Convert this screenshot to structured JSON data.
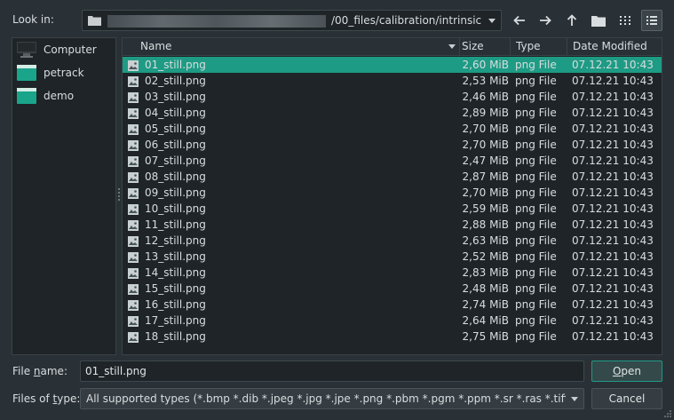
{
  "lookin": {
    "label": "Look in:",
    "path_suffix": "/00_files/calibration/intrinsic"
  },
  "sidebar": {
    "items": [
      {
        "label": "Computer",
        "icon": "computer-icon"
      },
      {
        "label": "petrack",
        "icon": "folder-icon"
      },
      {
        "label": "demo",
        "icon": "folder-icon"
      }
    ]
  },
  "list": {
    "headers": {
      "name": "Name",
      "size": "Size",
      "type": "Type",
      "date": "Date Modified"
    },
    "rows": [
      {
        "name": "01_still.png",
        "size": "2,60 MiB",
        "type": "png File",
        "date": "07.12.21 10:43",
        "selected": true
      },
      {
        "name": "02_still.png",
        "size": "2,53 MiB",
        "type": "png File",
        "date": "07.12.21 10:43"
      },
      {
        "name": "03_still.png",
        "size": "2,46 MiB",
        "type": "png File",
        "date": "07.12.21 10:43"
      },
      {
        "name": "04_still.png",
        "size": "2,89 MiB",
        "type": "png File",
        "date": "07.12.21 10:43"
      },
      {
        "name": "05_still.png",
        "size": "2,70 MiB",
        "type": "png File",
        "date": "07.12.21 10:43"
      },
      {
        "name": "06_still.png",
        "size": "2,70 MiB",
        "type": "png File",
        "date": "07.12.21 10:43"
      },
      {
        "name": "07_still.png",
        "size": "2,47 MiB",
        "type": "png File",
        "date": "07.12.21 10:43"
      },
      {
        "name": "08_still.png",
        "size": "2,87 MiB",
        "type": "png File",
        "date": "07.12.21 10:43"
      },
      {
        "name": "09_still.png",
        "size": "2,70 MiB",
        "type": "png File",
        "date": "07.12.21 10:43"
      },
      {
        "name": "10_still.png",
        "size": "2,59 MiB",
        "type": "png File",
        "date": "07.12.21 10:43"
      },
      {
        "name": "11_still.png",
        "size": "2,88 MiB",
        "type": "png File",
        "date": "07.12.21 10:43"
      },
      {
        "name": "12_still.png",
        "size": "2,63 MiB",
        "type": "png File",
        "date": "07.12.21 10:43"
      },
      {
        "name": "13_still.png",
        "size": "2,52 MiB",
        "type": "png File",
        "date": "07.12.21 10:43"
      },
      {
        "name": "14_still.png",
        "size": "2,83 MiB",
        "type": "png File",
        "date": "07.12.21 10:43"
      },
      {
        "name": "15_still.png",
        "size": "2,48 MiB",
        "type": "png File",
        "date": "07.12.21 10:43"
      },
      {
        "name": "16_still.png",
        "size": "2,74 MiB",
        "type": "png File",
        "date": "07.12.21 10:43"
      },
      {
        "name": "17_still.png",
        "size": "2,64 MiB",
        "type": "png File",
        "date": "07.12.21 10:43"
      },
      {
        "name": "18_still.png",
        "size": "2,75 MiB",
        "type": "png File",
        "date": "07.12.21 10:43"
      }
    ]
  },
  "filename": {
    "label_pre": "File ",
    "label_u": "n",
    "label_post": "ame:",
    "value": "01_still.png"
  },
  "filetype": {
    "label_pre": "Files of ",
    "label_u": "t",
    "label_post": "ype:",
    "value": "All supported types (*.bmp *.dib *.jpeg *.jpg *.jpe *.png *.pbm *.pgm *.ppm *.sr *.ras *.tiff *.tif"
  },
  "buttons": {
    "open_u": "O",
    "open_rest": "pen",
    "cancel": "Cancel"
  },
  "colors": {
    "accent": "#1e9b84",
    "background": "#2a3136",
    "panel": "#1e2427"
  }
}
